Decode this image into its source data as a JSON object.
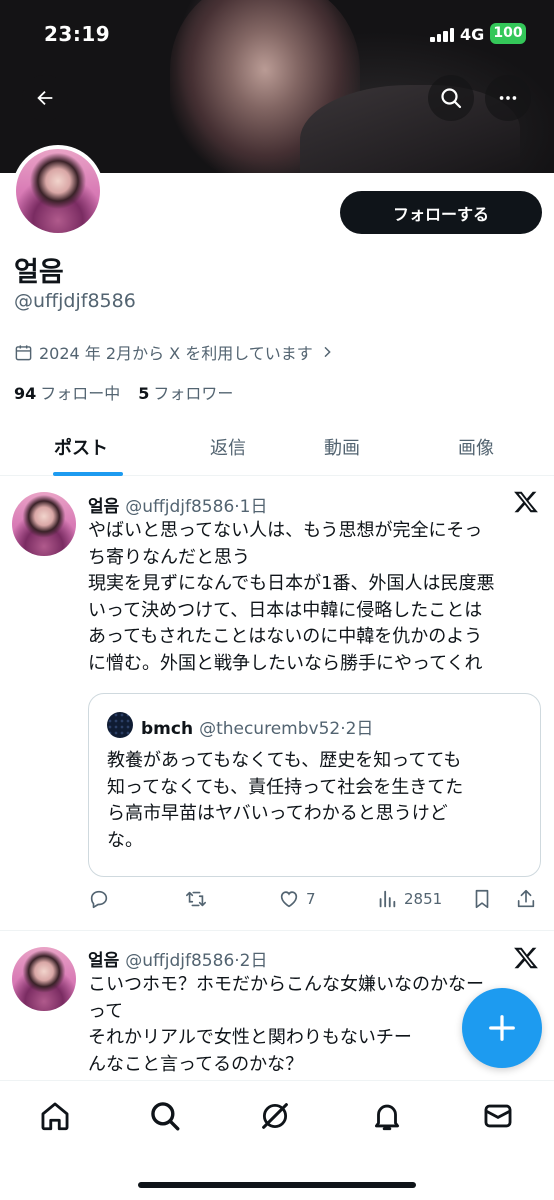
{
  "status_bar": {
    "time": "23:19",
    "network": "4G",
    "battery": "100"
  },
  "profile": {
    "name": "얼음",
    "handle": "@uffjdjf8586",
    "joined": "2024 年 2月から X を利用しています",
    "following_count": "94",
    "following_label": "フォロー中",
    "followers_count": "5",
    "followers_label": "フォロワー",
    "follow_button": "フォローする"
  },
  "tabs": [
    {
      "label": "ポスト",
      "active": true
    },
    {
      "label": "返信",
      "active": false
    },
    {
      "label": "動画",
      "active": false
    },
    {
      "label": "画像",
      "active": false
    }
  ],
  "posts": [
    {
      "name": "얼음",
      "handle": "@uffjdjf8586",
      "time": "1日",
      "text_lines": [
        "やばいと思ってない人は、もう思想が完全にそっ",
        "ち寄りなんだと思う",
        "現実を見ずになんでも日本が1番、外国人は民度悪",
        "いって決めつけて、日本は中韓に侵略したことは",
        "あってもされたことはないのに中韓を仇かのよう",
        "に憎む。外国と戦争したいなら勝手にやってくれ"
      ],
      "quote": {
        "name": "bmch",
        "handle": "@thecurembv52",
        "time": "2日",
        "text_lines": [
          "教養があってもなくても、歴史を知ってても",
          "知ってなくても、責任持って社会を生きてた",
          "ら高市早苗はヤバいってわかると思うけど",
          "な。"
        ]
      },
      "likes": "7",
      "views": "2851"
    },
    {
      "name": "얼음",
      "handle": "@uffjdjf8586",
      "time": "2日",
      "text_lines": [
        "こいつホモ？ホモだからこんな女嫌いなのかなー",
        "って",
        "それかリアルで女性と関わりもないチー",
        "んなこと言ってるのかな？"
      ]
    }
  ],
  "colors": {
    "accent": "#1d9bf0",
    "text": "#0f1419",
    "secondary": "#536471"
  }
}
